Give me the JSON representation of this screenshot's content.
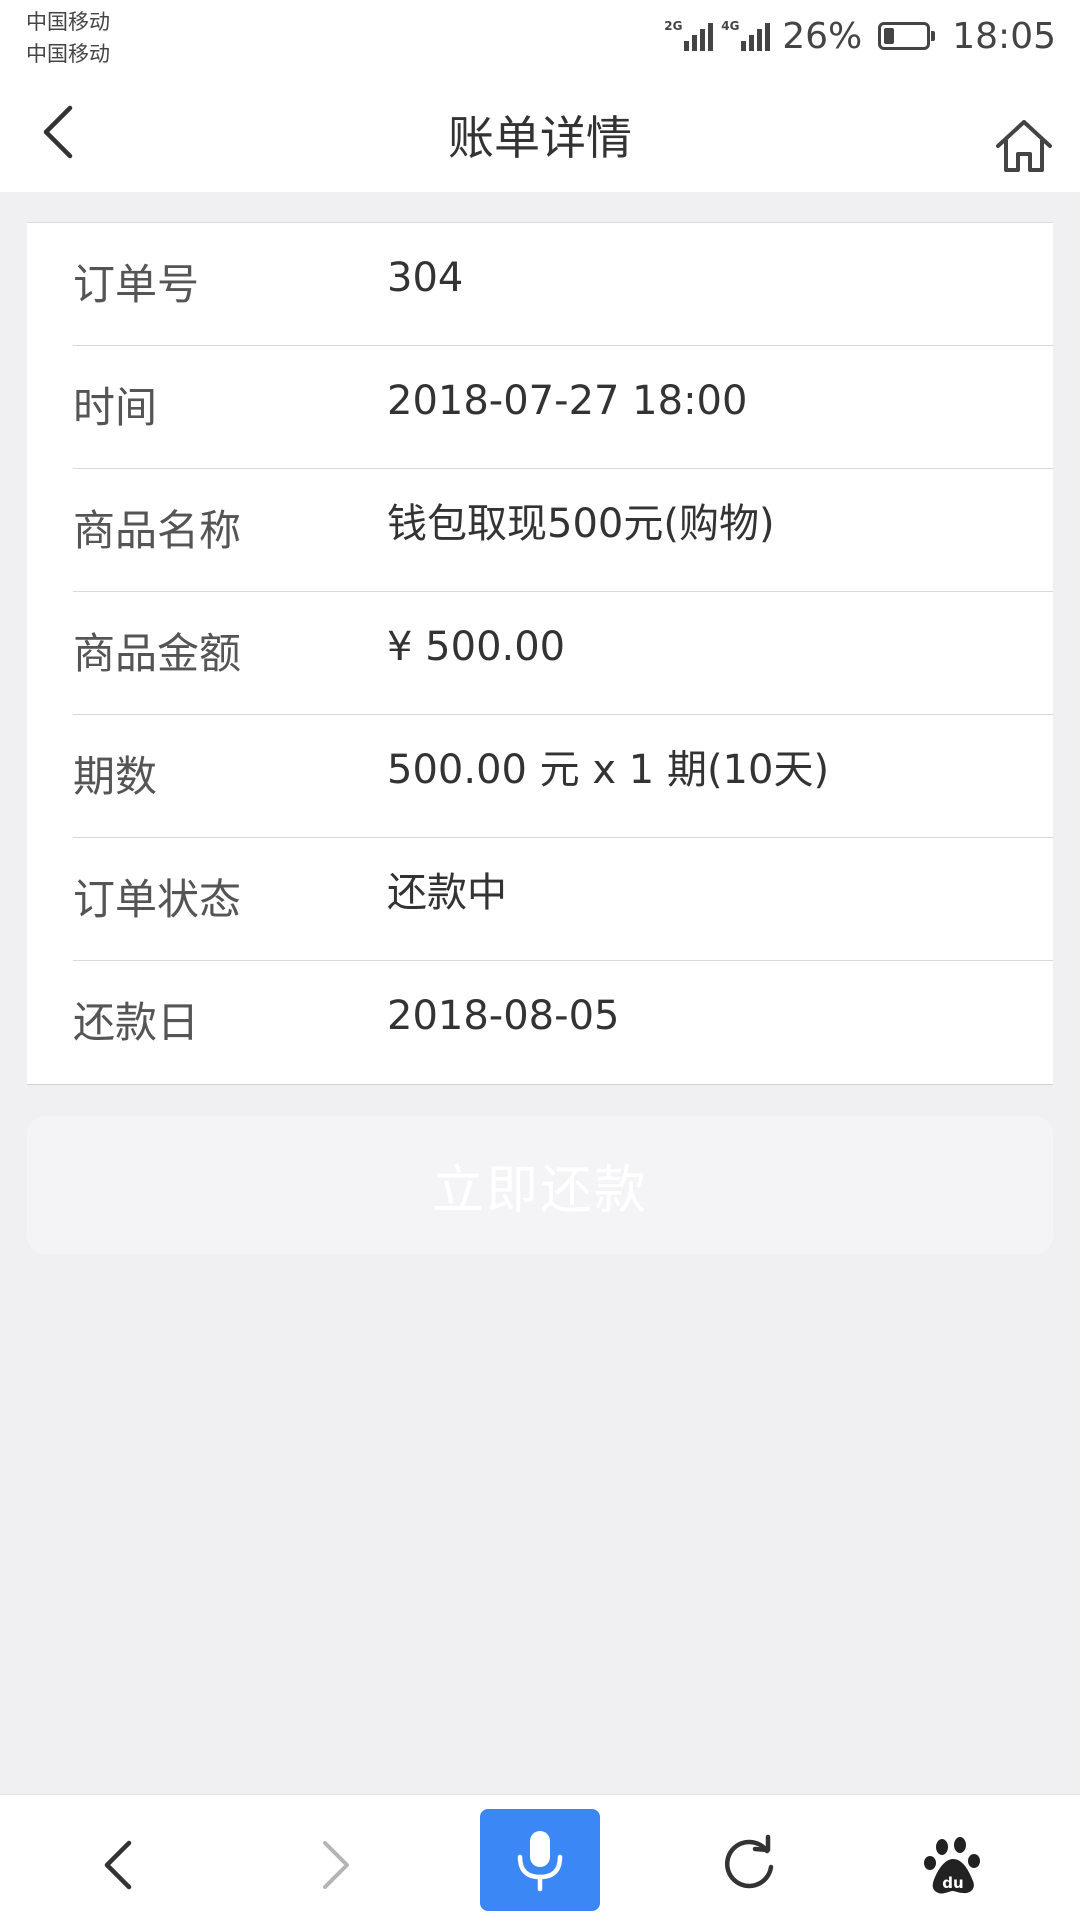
{
  "status_bar": {
    "carrier_1": "中国移动",
    "carrier_2": "中国移动",
    "signal_1_tag": "2G",
    "signal_2_tag": "4G",
    "battery_percent": "26%",
    "battery_level": 0.26,
    "time": "18:05"
  },
  "nav": {
    "title": "账单详情",
    "back_icon": "chevron-left-icon",
    "home_icon": "home-icon"
  },
  "details": [
    {
      "label": "订单号",
      "value": "304"
    },
    {
      "label": "时间",
      "value": "2018-07-27 18:00"
    },
    {
      "label": "商品名称",
      "value": "钱包取现500元(购物)"
    },
    {
      "label": "商品金额",
      "value": "¥ 500.00"
    },
    {
      "label": "期数",
      "value": "500.00 元 x 1 期(10天)"
    },
    {
      "label": "订单状态",
      "value": "还款中"
    },
    {
      "label": "还款日",
      "value": "2018-08-05"
    }
  ],
  "pay_button": {
    "label": "立即还款"
  },
  "bottom_bar": {
    "icons": [
      "back-icon",
      "forward-icon",
      "microphone-icon",
      "refresh-icon",
      "baidu-paw-icon"
    ],
    "accent_color": "#3b87f5"
  }
}
